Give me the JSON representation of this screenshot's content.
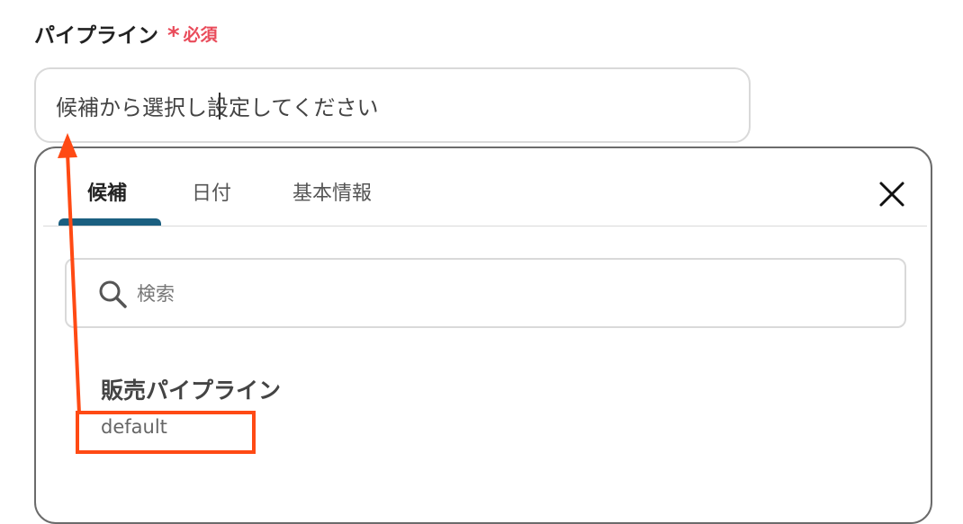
{
  "field": {
    "label": "パイプライン",
    "required_mark": "*",
    "required_text": "必須",
    "input_value": "候補から選択し設定してください"
  },
  "panel": {
    "tabs": [
      {
        "label": "候補",
        "active": true
      },
      {
        "label": "日付",
        "active": false
      },
      {
        "label": "基本情報",
        "active": false
      }
    ],
    "search": {
      "placeholder": "検索",
      "value": ""
    },
    "options": [
      {
        "title": "販売パイプライン",
        "subtitle": "default"
      }
    ]
  },
  "colors": {
    "accent_tab": "#1b5f80",
    "required": "#e94b5a",
    "annotation": "#ff4a14"
  },
  "icons": {
    "close": "close-icon",
    "search": "search-icon"
  }
}
